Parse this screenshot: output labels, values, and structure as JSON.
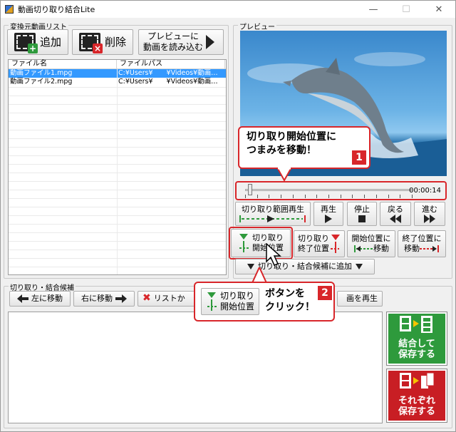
{
  "window": {
    "title": "動画切り取り結合Lite",
    "minimize": "—",
    "maximize": "☐",
    "close": "✕"
  },
  "source_group": {
    "label": "変換元動画リスト",
    "add_label": "追加",
    "delete_label": "削除",
    "load_preview_line1": "プレビューに",
    "load_preview_line2": "動画を読み込む",
    "columns": [
      "ファイル名",
      "ファイルパス"
    ],
    "rows": [
      {
        "name": "動画ファイル1.mpg",
        "path": "C:¥Users¥　　¥Videos¥動画…",
        "selected": true
      },
      {
        "name": "動画ファイル2.mpg",
        "path": "C:¥Users¥　　¥Videos¥動画…",
        "selected": false
      }
    ]
  },
  "preview_group": {
    "label": "プレビュー",
    "time": "00:00:14",
    "slider_position": 0.03,
    "range_play_label": "切り取り範囲再生",
    "play_label": "再生",
    "stop_label": "停止",
    "back_label": "戻る",
    "forward_label": "進む",
    "cut_start_line1": "切り取り",
    "cut_start_line2": "開始位置",
    "cut_end_line1": "切り取り",
    "cut_end_line2": "終了位置",
    "move_start_line1": "開始位置に",
    "move_start_line2": "移動",
    "move_end_line1": "終了位置に",
    "move_end_line2": "移動",
    "add_candidate_label": "切り取り・結合候補に追加"
  },
  "candidate_group": {
    "label": "切り取り・結合候補",
    "move_left_label": "左に移動",
    "move_right_label": "右に移動",
    "remove_label": "リストか",
    "play_label_tail": "画を再生",
    "join_save_line1": "結合して",
    "join_save_line2": "保存する",
    "each_save_line1": "それぞれ",
    "each_save_line2": "保存する"
  },
  "callouts": {
    "step1_line1": "切り取り開始位置に",
    "step1_line2": "つまみを移動！",
    "step1_number": "1",
    "step2_btn_line1": "切り取り",
    "step2_btn_line2": "開始位置",
    "step2_line1": "ボタンを",
    "step2_line2": "クリック！",
    "step2_number": "2"
  },
  "colors": {
    "accent": "#d8262a",
    "selection": "#3399ff",
    "join_green": "#2e9a3c",
    "each_red": "#c81e24"
  }
}
